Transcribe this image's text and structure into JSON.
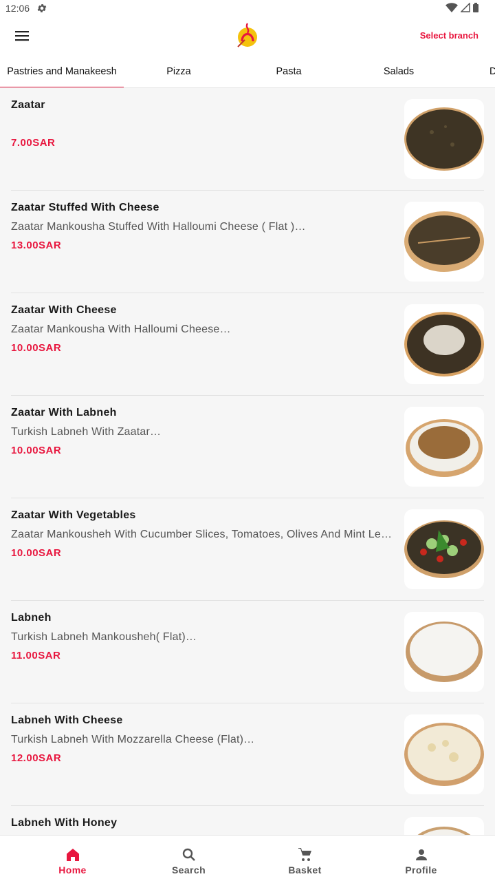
{
  "status_bar": {
    "time": "12:06"
  },
  "header": {
    "select_branch": "Select branch"
  },
  "tabs": [
    {
      "label": "Pastries and Manakeesh",
      "active": true
    },
    {
      "label": "Pizza",
      "active": false
    },
    {
      "label": "Pasta",
      "active": false
    },
    {
      "label": "Salads",
      "active": false
    },
    {
      "label": "D",
      "active": false
    }
  ],
  "items": [
    {
      "name": "Zaatar",
      "desc": "",
      "price": "7.00SAR"
    },
    {
      "name": "Zaatar Stuffed With Cheese",
      "desc": "Zaatar Mankousha Stuffed With Halloumi Cheese ( Flat )…",
      "price": "13.00SAR"
    },
    {
      "name": "Zaatar With Cheese",
      "desc": "Zaatar Mankousha With Halloumi Cheese…",
      "price": "10.00SAR"
    },
    {
      "name": "Zaatar With Labneh",
      "desc": "Turkish Labneh With Zaatar…",
      "price": "10.00SAR"
    },
    {
      "name": "Zaatar With Vegetables",
      "desc": "Zaatar Mankousheh With Cucumber Slices, Tomatoes, Olives And Mint Le…",
      "price": "10.00SAR"
    },
    {
      "name": "Labneh",
      "desc": "Turkish Labneh Mankousheh( Flat)…",
      "price": "11.00SAR"
    },
    {
      "name": "Labneh With Cheese",
      "desc": "Turkish Labneh With Mozzarella Cheese (Flat)…",
      "price": "12.00SAR"
    },
    {
      "name": "Labneh With Honey",
      "desc": "",
      "price": ""
    }
  ],
  "bottom_nav": {
    "home": "Home",
    "search": "Search",
    "basket": "Basket",
    "profile": "Profile"
  },
  "colors": {
    "accent": "#e8173f",
    "background": "#f6f6f6"
  },
  "icons": {
    "menu": "hamburger-menu-icon",
    "settings": "gear-icon",
    "home": "home-icon",
    "search": "search-icon",
    "basket": "cart-icon",
    "profile": "person-icon"
  }
}
